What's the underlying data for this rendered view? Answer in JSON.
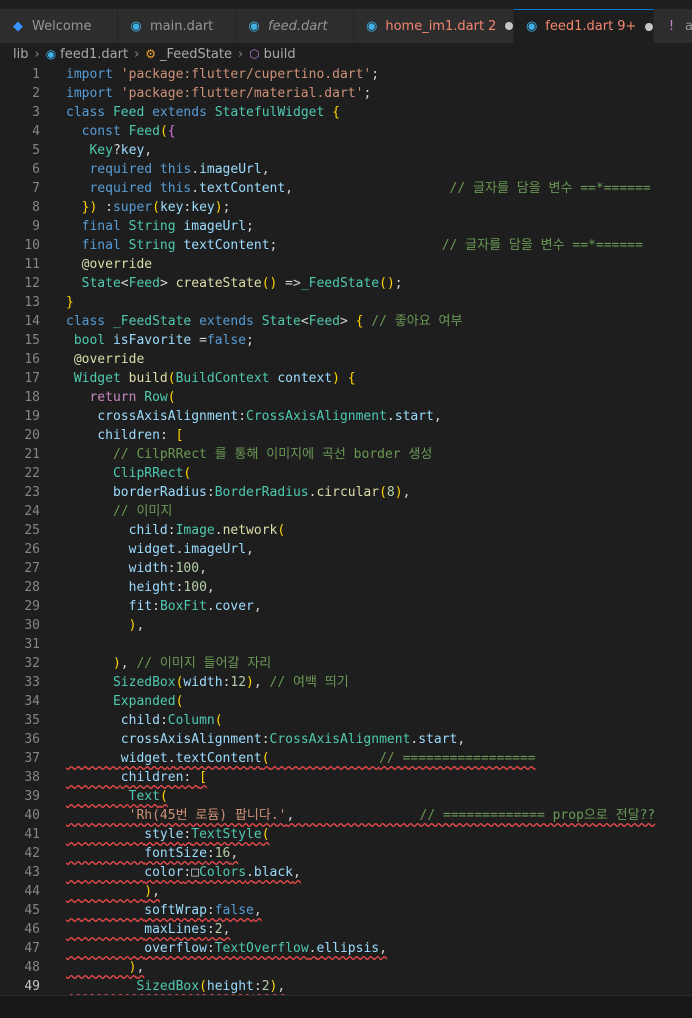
{
  "tabs": [
    {
      "icon": "vscode-icon",
      "glyph": "◆",
      "label": "Welcome",
      "italic": false,
      "badge": "",
      "dot": false,
      "active": false,
      "color": "#3794ff"
    },
    {
      "icon": "dart-icon",
      "glyph": "◉",
      "label": "main.dart",
      "italic": false,
      "badge": "",
      "dot": false,
      "active": false,
      "color": "#41b0e6"
    },
    {
      "icon": "dart-icon",
      "glyph": "◉",
      "label": "feed.dart",
      "italic": true,
      "badge": "",
      "dot": false,
      "active": false,
      "color": "#41b0e6"
    },
    {
      "icon": "dart-icon",
      "glyph": "◉",
      "label": "home_im1.dart",
      "italic": false,
      "badge": "2",
      "dot": true,
      "active": false,
      "color": "#41b0e6",
      "text_color": "#f48771"
    },
    {
      "icon": "dart-icon",
      "glyph": "◉",
      "label": "feed1.dart",
      "italic": false,
      "badge": "9+",
      "dot": true,
      "active": true,
      "color": "#41b0e6",
      "text_color": "#f48771"
    },
    {
      "icon": "exclamation-icon",
      "glyph": "!",
      "label": "a",
      "italic": false,
      "badge": "",
      "dot": false,
      "active": false,
      "color": "#c586c0"
    }
  ],
  "breadcrumb": {
    "folder": "lib",
    "file": "feed1.dart",
    "class": "_FeedState",
    "method": "build"
  },
  "lines": [
    {
      "n": "1",
      "code": "import 'package:flutter/cupertino.dart';"
    },
    {
      "n": "2",
      "code": "import 'package:flutter/material.dart';"
    },
    {
      "n": "3",
      "code": "class Feed extends StatefulWidget {"
    },
    {
      "n": "4",
      "code": "  const Feed({"
    },
    {
      "n": "5",
      "code": "   Key?key,"
    },
    {
      "n": "6",
      "code": "   required this.imageUrl,"
    },
    {
      "n": "7",
      "code": "   required this.textContent,                    // 글자를 담을 변수 ==*======"
    },
    {
      "n": "8",
      "code": "  }) :super(key:key);"
    },
    {
      "n": "9",
      "code": "  final String imageUrl;"
    },
    {
      "n": "10",
      "code": "  final String textContent;                     // 글자를 담을 변수 ==*======"
    },
    {
      "n": "11",
      "code": "  @override"
    },
    {
      "n": "12",
      "code": "  State<Feed> createState() =>_FeedState();"
    },
    {
      "n": "13",
      "code": "}"
    },
    {
      "n": "14",
      "code": "class _FeedState extends State<Feed> { // 좋아요 여부"
    },
    {
      "n": "15",
      "code": " bool isFavorite =false;"
    },
    {
      "n": "16",
      "code": " @override"
    },
    {
      "n": "17",
      "code": " Widget build(BuildContext context) {"
    },
    {
      "n": "18",
      "code": "   return Row("
    },
    {
      "n": "19",
      "code": "    crossAxisAlignment:CrossAxisAlignment.start,"
    },
    {
      "n": "20",
      "code": "    children: ["
    },
    {
      "n": "21",
      "code": "      // CilpRRect 를 통해 이미지에 곡선 border 생성"
    },
    {
      "n": "22",
      "code": "      ClipRRect("
    },
    {
      "n": "23",
      "code": "      borderRadius:BorderRadius.circular(8),"
    },
    {
      "n": "24",
      "code": "      // 이미지"
    },
    {
      "n": "25",
      "code": "        child:Image.network("
    },
    {
      "n": "26",
      "code": "        widget.imageUrl,"
    },
    {
      "n": "27",
      "code": "        width:100,"
    },
    {
      "n": "28",
      "code": "        height:100,"
    },
    {
      "n": "29",
      "code": "        fit:BoxFit.cover,"
    },
    {
      "n": "30",
      "code": "        ),"
    },
    {
      "n": "31",
      "code": ""
    },
    {
      "n": "32",
      "code": "      ), // 이미지 들어갈 자리"
    },
    {
      "n": "33",
      "code": "      SizedBox(width:12), // 여백 띄기"
    },
    {
      "n": "34",
      "code": "      Expanded("
    },
    {
      "n": "35",
      "code": "       child:Column("
    },
    {
      "n": "36",
      "code": "       crossAxisAlignment:CrossAxisAlignment.start,"
    },
    {
      "n": "37",
      "code": "       widget.textContent(              // ================="
    },
    {
      "n": "38",
      "code": "       children: ["
    },
    {
      "n": "39",
      "code": "        Text("
    },
    {
      "n": "40",
      "code": "        'Rh(45번 로듐) 팝니다.',                // ============= prop으로 전달??"
    },
    {
      "n": "41",
      "code": "          style:TextStyle("
    },
    {
      "n": "42",
      "code": "          fontSize:16,"
    },
    {
      "n": "43",
      "code": "          color:□Colors.black,"
    },
    {
      "n": "44",
      "code": "          ),"
    },
    {
      "n": "45",
      "code": "          softWrap:false,"
    },
    {
      "n": "46",
      "code": "          maxLines:2,"
    },
    {
      "n": "47",
      "code": "          overflow:TextOverflow.ellipsis,"
    },
    {
      "n": "48",
      "code": "        ),"
    },
    {
      "n": "49",
      "code": "         SizedBox(height:2),"
    }
  ]
}
